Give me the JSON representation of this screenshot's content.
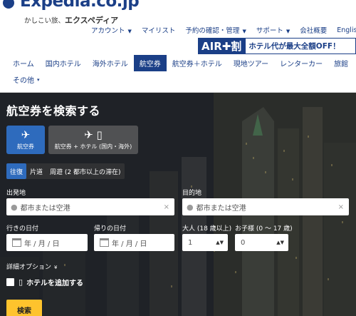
{
  "header": {
    "logo_text": "Expedia.co.jp",
    "tagline_prefix": "かしこい旅、",
    "tagline_brand": "エクスペディア",
    "top_links": [
      {
        "label": "アカウント",
        "caret": true
      },
      {
        "label": "マイリスト",
        "caret": false
      },
      {
        "label": "予約の確認・管理",
        "caret": true
      },
      {
        "label": "サポート",
        "caret": true
      },
      {
        "label": "会社概要",
        "caret": false
      },
      {
        "label": "English",
        "caret": false
      }
    ],
    "banner": {
      "air": "AIR✚割",
      "text": "ホテル代が最大全額OFF！"
    },
    "nav": [
      "ホーム",
      "国内ホテル",
      "海外ホテル",
      "航空券",
      "航空券＋ホテル",
      "現地ツアー",
      "レンターカー",
      "旅館",
      "その他"
    ],
    "nav_active": "航空券",
    "nav_more_caret": "▾"
  },
  "hero": {
    "title": "航空券を検索する",
    "modes": [
      {
        "icon": "✈",
        "label": "航空券"
      },
      {
        "icon": "✈ ▯",
        "label": "航空券 + ホテル (国内・海外)"
      }
    ],
    "trip_types": [
      "往復",
      "片道",
      "周遊 (2 都市以上の滞在)"
    ],
    "origin": {
      "label": "出発地",
      "placeholder": "都市または空港",
      "clear": "×"
    },
    "destination": {
      "label": "目的地",
      "placeholder": "都市または空港",
      "clear": "×"
    },
    "depart_date": {
      "label": "行きの日付",
      "placeholder": "年 / 月 / 日"
    },
    "return_date": {
      "label": "帰りの日付",
      "placeholder": "年 / 月 / 日"
    },
    "adults": {
      "label": "大人 (18 歳以上)",
      "value": "1"
    },
    "children": {
      "label": "お子様 (0 ～ 17 歳)",
      "value": "0"
    },
    "options_link": "詳細オプション",
    "options_caret": "¥",
    "add_hotel": "ホテルを追加する",
    "search_button": "検索"
  }
}
